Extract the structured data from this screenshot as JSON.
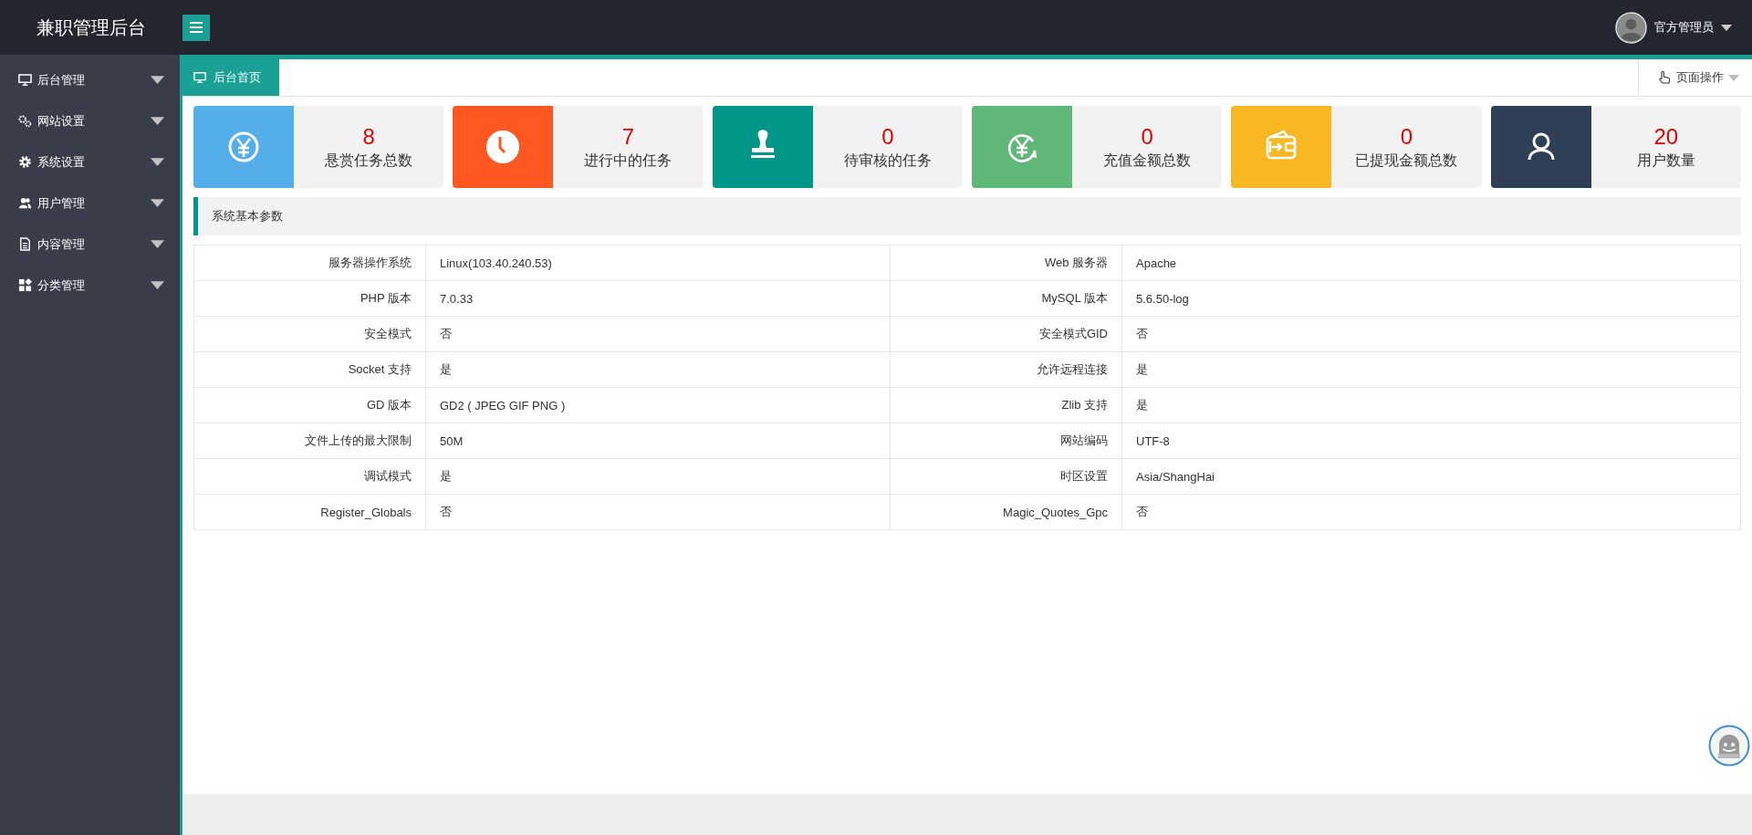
{
  "header": {
    "title": "兼职管理后台",
    "user": "官方管理员"
  },
  "sidebar": {
    "items": [
      {
        "label": "后台管理",
        "expanded": false
      },
      {
        "label": "网站设置",
        "expanded": false
      },
      {
        "label": "系统设置",
        "expanded": false
      },
      {
        "label": "用户管理",
        "expanded": false
      },
      {
        "label": "内容管理",
        "expanded": false
      },
      {
        "label": "分类管理",
        "expanded": false
      }
    ]
  },
  "tabs": [
    {
      "label": "后台首页",
      "selected": true
    }
  ],
  "page_actions": {
    "label": "页面操作"
  },
  "stats": [
    {
      "value": "8",
      "label": "悬赏任务总数",
      "color": "#53aee9"
    },
    {
      "value": "7",
      "label": "进行中的任务",
      "color": "#ff5722"
    },
    {
      "value": "0",
      "label": "待审核的任务",
      "color": "#009688"
    },
    {
      "value": "0",
      "label": "充值金额总数",
      "color": "#5fb878"
    },
    {
      "value": "0",
      "label": "已提现金额总数",
      "color": "#f7b824"
    },
    {
      "value": "20",
      "label": "用户数量",
      "color": "#2f4056"
    }
  ],
  "section": {
    "title": "系统基本参数"
  },
  "params": {
    "rows": [
      [
        "服务器操作系统",
        "Linux(103.40.240.53)",
        "Web 服务器",
        "Apache"
      ],
      [
        "PHP 版本",
        "7.0.33",
        "MySQL 版本",
        "5.6.50-log"
      ],
      [
        "安全模式",
        "否",
        "安全模式GID",
        "否"
      ],
      [
        "Socket 支持",
        "是",
        "允许远程连接",
        "是"
      ],
      [
        "GD 版本",
        "GD2 ( JPEG GIF PNG )",
        "Zlib 支持",
        "是"
      ],
      [
        "文件上传的最大限制",
        "50M",
        "网站编码",
        "UTF-8"
      ],
      [
        "调试模式",
        "是",
        "时区设置",
        "Asia/ShangHai"
      ],
      [
        "Register_Globals",
        "否",
        "Magic_Quotes_Gpc",
        "否"
      ]
    ]
  }
}
